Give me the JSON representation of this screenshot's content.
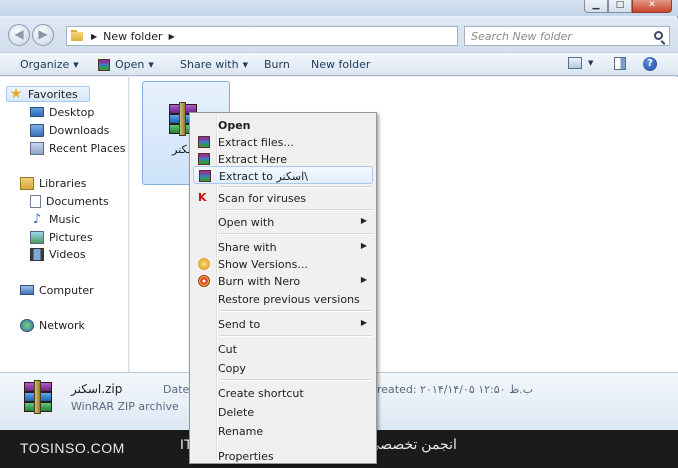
{
  "window": {
    "address": {
      "crumb": "New folder"
    },
    "search": {
      "placeholder": "Search New folder"
    }
  },
  "toolbar": {
    "organize": "Organize",
    "open": "Open",
    "share_with": "Share with",
    "burn": "Burn",
    "new_folder": "New folder"
  },
  "nav": {
    "favorites": "Favorites",
    "desktop": "Desktop",
    "downloads": "Downloads",
    "recent_places": "Recent Places",
    "libraries": "Libraries",
    "documents": "Documents",
    "music": "Music",
    "pictures": "Pictures",
    "videos": "Videos",
    "computer": "Computer",
    "network": "Network"
  },
  "content": {
    "file_name": "اسکنر"
  },
  "details": {
    "name": "اسکنر.zip",
    "type": "WinRAR ZIP archive",
    "date_label": "Date c",
    "created": "reated: ۲۰۱۴/۱۴/۰۵ ب.ظ ۱۲:۵۰"
  },
  "context_menu": {
    "open": "Open",
    "extract_files": "Extract files...",
    "extract_here": "Extract Here",
    "extract_to": "Extract to اسکنر\\",
    "scan": "Scan for viruses",
    "open_with": "Open with",
    "share_with": "Share with",
    "show_versions": "Show Versions...",
    "burn_with_nero": "Burn with Nero",
    "restore_versions": "Restore previous versions",
    "send_to": "Send to",
    "cut": "Cut",
    "copy": "Copy",
    "create_shortcut": "Create shortcut",
    "delete": "Delete",
    "rename": "Rename",
    "properties": "Properties"
  },
  "footer": {
    "left": "TOSINSO.COM",
    "right": "انجمن تخصصی فناوری اطلاعات ایران - ITPro.ir"
  },
  "icons": [
    "back-icon",
    "forward-icon",
    "folder-icon",
    "search-icon",
    "winrar-icon",
    "star-icon",
    "help-icon"
  ]
}
